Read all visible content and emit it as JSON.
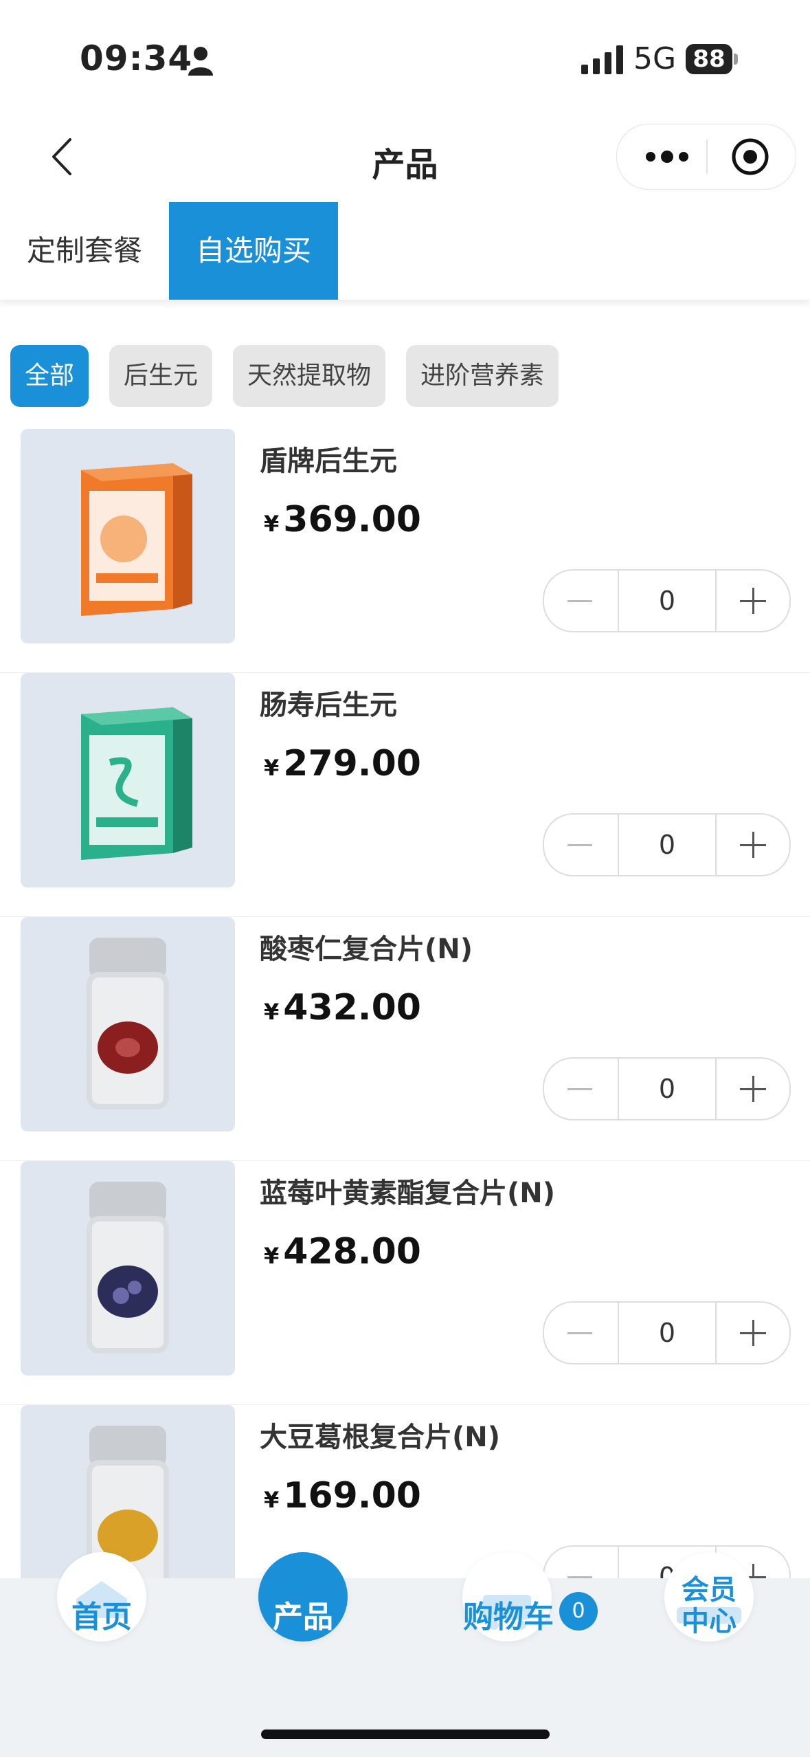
{
  "status_bar": {
    "time": "09:34",
    "network": "5G",
    "battery": "88"
  },
  "nav": {
    "title": "产品"
  },
  "tabs": [
    {
      "label": "定制套餐",
      "active": false
    },
    {
      "label": "自选购买",
      "active": true
    }
  ],
  "filters": [
    {
      "label": "全部",
      "active": true
    },
    {
      "label": "后生元",
      "active": false
    },
    {
      "label": "天然提取物",
      "active": false
    },
    {
      "label": "进阶营养素",
      "active": false
    }
  ],
  "currency_symbol": "¥",
  "products": [
    {
      "name": "盾牌后生元",
      "price": "369.00",
      "qty": "0"
    },
    {
      "name": "肠寿后生元",
      "price": "279.00",
      "qty": "0"
    },
    {
      "name": "酸枣仁复合片(N)",
      "price": "432.00",
      "qty": "0"
    },
    {
      "name": "蓝莓叶黄素酯复合片(N)",
      "price": "428.00",
      "qty": "0"
    },
    {
      "name": "大豆葛根复合片(N)",
      "price": "169.00",
      "qty": "0"
    }
  ],
  "bottom_nav": {
    "home": "首页",
    "products": "产品",
    "cart": "购物车",
    "cart_count": "0",
    "member_line1": "会员",
    "member_line2": "中心"
  },
  "colors": {
    "accent": "#1a90d9",
    "chip_bg": "#e6e6e6",
    "thumb_bg": "#dfe6ef"
  }
}
